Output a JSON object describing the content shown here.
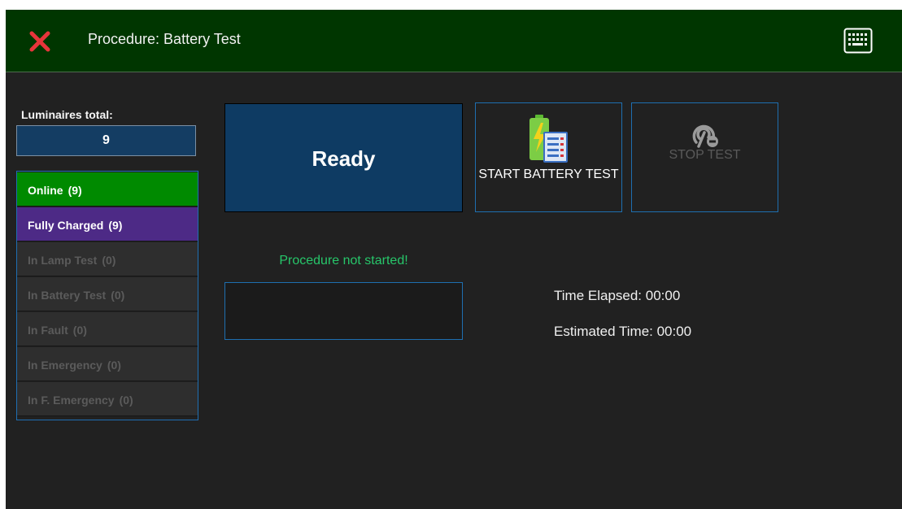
{
  "header": {
    "title": "Procedure: Battery Test",
    "close_icon": "close-icon",
    "keyboard_icon": "keyboard-icon"
  },
  "luminaires": {
    "label": "Luminaires total:",
    "total": "9"
  },
  "status_list": [
    {
      "label": "Online",
      "count": "(9)",
      "active": true,
      "color": "#008a00"
    },
    {
      "label": "Fully Charged",
      "count": "(9)",
      "active": true,
      "color": "#4d2a86"
    },
    {
      "label": "In Lamp Test",
      "count": "(0)",
      "active": false
    },
    {
      "label": "In Battery Test",
      "count": "(0)",
      "active": false
    },
    {
      "label": "In Fault",
      "count": "(0)",
      "active": false
    },
    {
      "label": "In Emergency",
      "count": "(0)",
      "active": false
    },
    {
      "label": "In F. Emergency",
      "count": "(0)",
      "active": false
    }
  ],
  "state_panel": {
    "label": "Ready"
  },
  "actions": {
    "start_label": "START BATTERY TEST",
    "start_icon": "battery-test-icon",
    "stop_label": "STOP TEST",
    "stop_icon": "stop-test-icon",
    "stop_enabled": false
  },
  "procedure": {
    "status_text": "Procedure not started!",
    "time_elapsed": "Time Elapsed: 00:00",
    "estimated_time": "Estimated Time: 00:00"
  },
  "colors": {
    "header_bg": "#003600",
    "accent_blue": "#1e6fb0",
    "status_green": "#27c66a"
  }
}
